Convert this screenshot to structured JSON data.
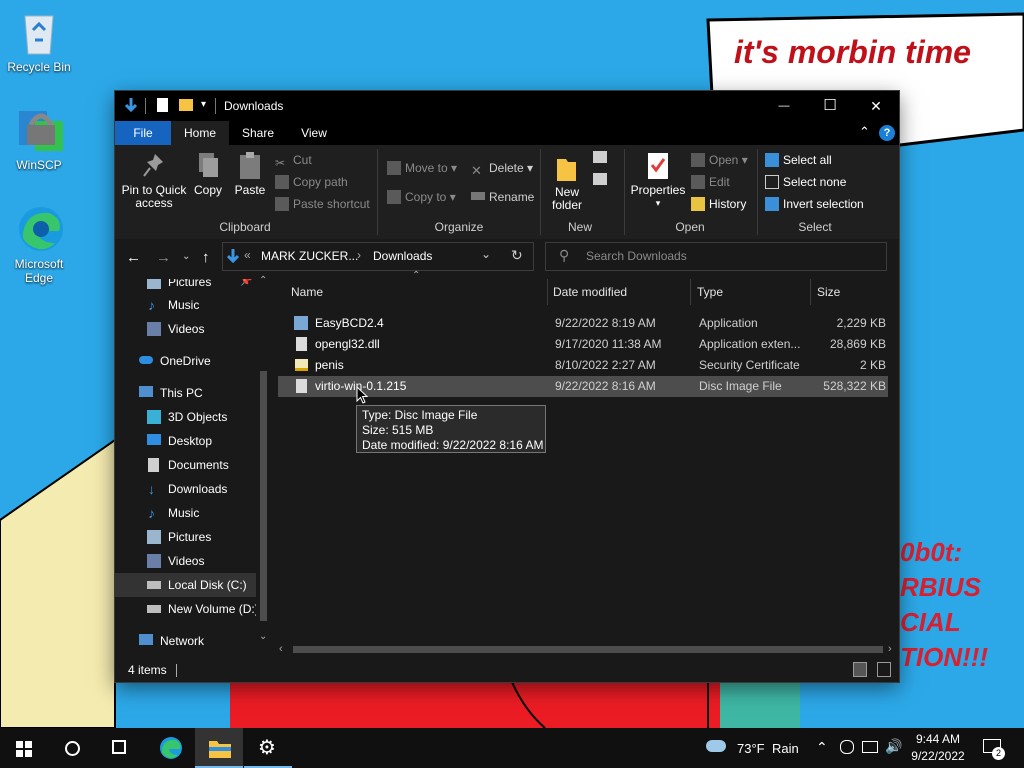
{
  "desktop": {
    "icons": [
      {
        "label": "Recycle Bin",
        "icon": "recycle-bin-icon"
      },
      {
        "label": "WinSCP",
        "icon": "winscp-icon"
      },
      {
        "label": "Microsoft\nEdge",
        "icon": "edge-icon"
      }
    ],
    "speech_bubble": "it's morbin time",
    "red_text": [
      "0b0t:",
      "RBIUS",
      "CIAL",
      "TION!!!"
    ]
  },
  "window": {
    "title": "Downloads",
    "controls": {
      "minimize": "—",
      "maximize": "☐",
      "close": "✕"
    },
    "tabs": [
      "File",
      "Home",
      "Share",
      "View"
    ],
    "ribbon": {
      "clipboard": {
        "label": "Clipboard",
        "pin": "Pin to Quick\naccess",
        "copy": "Copy",
        "paste": "Paste",
        "cut": "Cut",
        "copy_path": "Copy path",
        "paste_shortcut": "Paste shortcut"
      },
      "organize": {
        "label": "Organize",
        "move_to": "Move to",
        "copy_to": "Copy to",
        "delete": "Delete",
        "rename": "Rename"
      },
      "new": {
        "label": "New",
        "new_folder": "New\nfolder"
      },
      "open": {
        "label": "Open",
        "properties": "Properties",
        "open": "Open",
        "edit": "Edit",
        "history": "History"
      },
      "select": {
        "label": "Select",
        "select_all": "Select all",
        "select_none": "Select none",
        "invert": "Invert selection"
      }
    },
    "address": {
      "crumbs": [
        "MARK ZUCKER...",
        "Downloads"
      ],
      "search_placeholder": "Search Downloads"
    },
    "nav": {
      "items": [
        {
          "label": "Pictures",
          "icon": "pictures-icon"
        },
        {
          "label": "Music",
          "icon": "music-icon"
        },
        {
          "label": "Videos",
          "icon": "videos-icon"
        },
        {
          "label": "OneDrive",
          "icon": "onedrive-icon"
        },
        {
          "label": "This PC",
          "icon": "this-pc-icon"
        },
        {
          "label": "3D Objects",
          "icon": "3d-objects-icon"
        },
        {
          "label": "Desktop",
          "icon": "desktop-icon"
        },
        {
          "label": "Documents",
          "icon": "documents-icon"
        },
        {
          "label": "Downloads",
          "icon": "downloads-icon"
        },
        {
          "label": "Music",
          "icon": "music-icon"
        },
        {
          "label": "Pictures",
          "icon": "pictures-icon"
        },
        {
          "label": "Videos",
          "icon": "videos-icon"
        },
        {
          "label": "Local Disk (C:)",
          "icon": "local-disk-icon"
        },
        {
          "label": "New Volume (D:)",
          "icon": "volume-icon"
        },
        {
          "label": "Network",
          "icon": "network-icon"
        }
      ]
    },
    "columns": [
      "Name",
      "Date modified",
      "Type",
      "Size"
    ],
    "files": [
      {
        "name": "EasyBCD2.4",
        "date": "9/22/2022 8:19 AM",
        "type": "Application",
        "size": "2,229 KB",
        "icon": "app-icon"
      },
      {
        "name": "opengl32.dll",
        "date": "9/17/2020 11:38 AM",
        "type": "Application exten...",
        "size": "28,869 KB",
        "icon": "dll-icon"
      },
      {
        "name": "penis",
        "date": "8/10/2022 2:27 AM",
        "type": "Security Certificate",
        "size": "2 KB",
        "icon": "certificate-icon"
      },
      {
        "name": "virtio-win-0.1.215",
        "date": "9/22/2022 8:16 AM",
        "type": "Disc Image File",
        "size": "528,322 KB",
        "icon": "disc-image-icon"
      }
    ],
    "tooltip": [
      "Type: Disc Image File",
      "Size: 515 MB",
      "Date modified: 9/22/2022 8:16 AM"
    ],
    "status": {
      "items": "4 items"
    }
  },
  "taskbar": {
    "weather": {
      "temp": "73°F",
      "condition": "Rain"
    },
    "time": "9:44 AM",
    "date": "9/22/2022",
    "notification_count": "2"
  }
}
